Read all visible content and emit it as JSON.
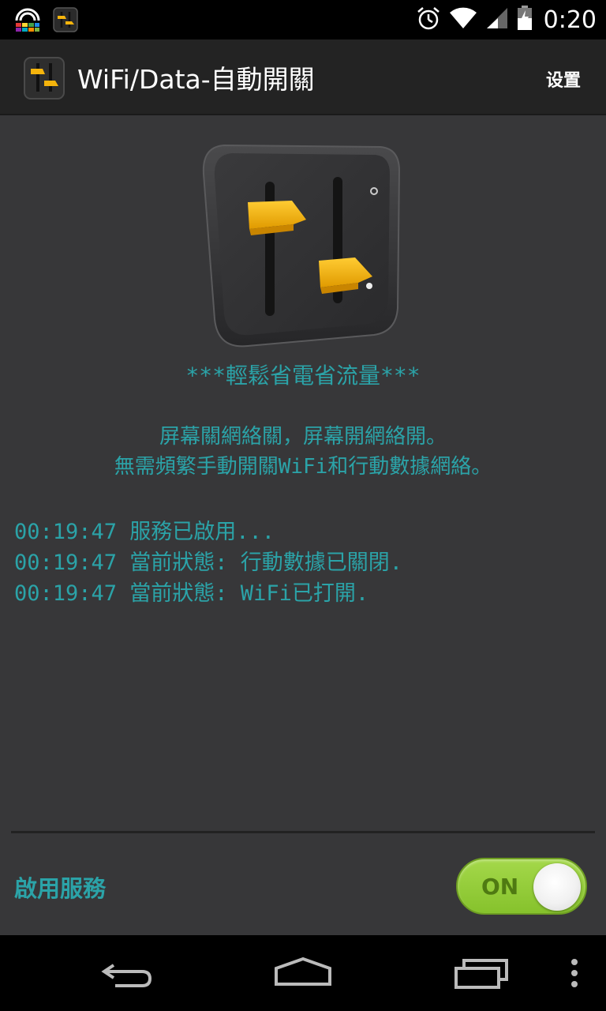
{
  "status_bar": {
    "time": "0:20",
    "left_icons": [
      "keyboard-rainbow-icon",
      "app-notification-icon"
    ],
    "right_icons": [
      "alarm-icon",
      "wifi-icon",
      "cell-signal-icon",
      "battery-charging-icon"
    ]
  },
  "action_bar": {
    "title": "WiFi/Data-自動開關",
    "settings_label": "设置"
  },
  "main": {
    "tagline": "***輕鬆省電省流量***",
    "description": [
      "屏幕關網絡關，屏幕開網絡開。",
      "無需頻繁手動開關WiFi和行動數據網絡。"
    ],
    "log": [
      "00:19:47 服務已啟用...",
      "00:19:47 當前狀態: 行動數據已關閉.",
      "00:19:47 當前狀態: WiFi已打開."
    ],
    "enable_service_label": "啟用服務",
    "toggle": {
      "label": "ON",
      "state": "on"
    }
  },
  "colors": {
    "accent": "#2ba3a8",
    "toggle_on": "#94cc3a",
    "background": "#373739",
    "action_bar": "#232323",
    "slider_knob": "#f5b40c"
  },
  "nav_bar": {
    "buttons": [
      "back-icon",
      "home-icon",
      "recent-apps-icon",
      "overflow-menu-icon"
    ]
  }
}
